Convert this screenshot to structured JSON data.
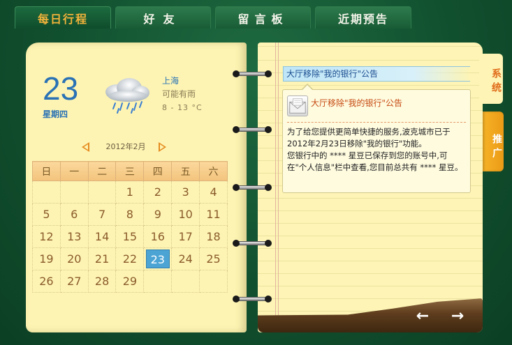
{
  "tabs": [
    {
      "label": "每日行程",
      "active": true
    },
    {
      "label": "好友",
      "active": false
    },
    {
      "label": "留言板",
      "active": false
    },
    {
      "label": "近期预告",
      "active": false
    }
  ],
  "date": {
    "day": "23",
    "weekday": "星期四"
  },
  "weather": {
    "icon": "cloud-rain-icon",
    "city": "上海",
    "forecast": "可能有雨",
    "temp": "8 - 13 °C"
  },
  "calendar": {
    "month_label": "2012年2月",
    "weekdays": [
      "日",
      "一",
      "二",
      "三",
      "四",
      "五",
      "六"
    ],
    "weeks": [
      [
        "",
        "",
        "",
        "1",
        "2",
        "3",
        "4"
      ],
      [
        "5",
        "6",
        "7",
        "8",
        "9",
        "10",
        "11"
      ],
      [
        "12",
        "13",
        "14",
        "15",
        "16",
        "17",
        "18"
      ],
      [
        "19",
        "20",
        "21",
        "22",
        "23",
        "24",
        "25"
      ],
      [
        "26",
        "27",
        "28",
        "29",
        "",
        "",
        ""
      ]
    ],
    "today": "23"
  },
  "side_tabs": {
    "system": "系统",
    "promo": "推广"
  },
  "notice": {
    "title": "大厅移除\"我的银行\"公告",
    "popup_title": "大厅移除\"我的银行\"公告",
    "body": "为了给您提供更简单快捷的服务,波克城市已于2012年2月23日移除\"我的银行\"功能。\n您银行中的 **** 星豆已保存到您的账号中,可在\"个人信息\"栏中查看,您目前总共有 **** 星豆。"
  },
  "nav": {
    "back": "←",
    "forward": "→"
  },
  "colors": {
    "accent_tab": "#f3b33a",
    "date_blue": "#2a72b5",
    "today_bg": "#4ba4d4",
    "orange": "#e58b20"
  }
}
